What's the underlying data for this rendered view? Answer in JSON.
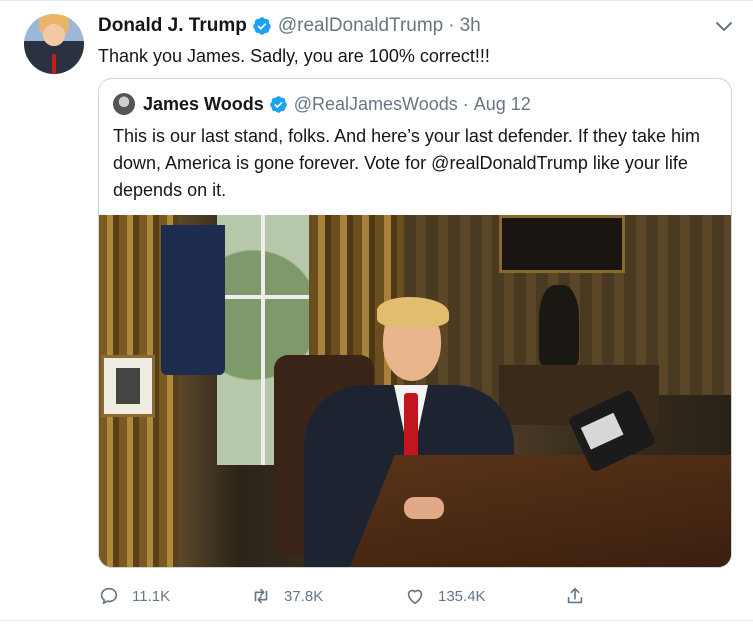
{
  "tweet": {
    "author_name": "Donald J. Trump",
    "author_handle": "@realDonaldTrump",
    "separator": "·",
    "time": "3h",
    "text": "Thank you James. Sadly, you are 100% correct!!!"
  },
  "quoted_tweet": {
    "author_name": "James Woods",
    "author_handle": "@RealJamesWoods",
    "separator": "·",
    "time": "Aug 12",
    "text": "This is our last stand, folks. And here’s your last defender. If they take him down, America is gone forever. Vote for @realDonaldTrump like your life depends on it."
  },
  "actions": {
    "replies": "11.1K",
    "retweets": "37.8K",
    "likes": "135.4K"
  },
  "colors": {
    "verified_badge": "#1da1f2",
    "secondary_text": "#657786",
    "border": "#ccd6dd"
  },
  "icons": [
    "verified-badge-icon",
    "chevron-down-icon",
    "reply-icon",
    "retweet-icon",
    "like-icon",
    "share-icon"
  ]
}
